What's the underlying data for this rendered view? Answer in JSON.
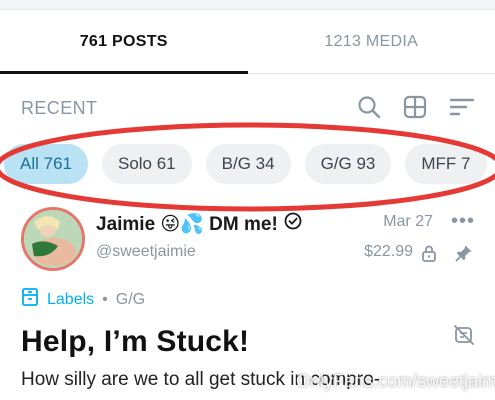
{
  "tabs": [
    {
      "label": "761 POSTS",
      "active": true
    },
    {
      "label": "1213 MEDIA",
      "active": false
    }
  ],
  "section": {
    "title": "RECENT"
  },
  "toolbar": {
    "icons": [
      "search-icon",
      "grid-icon",
      "sort-icon"
    ]
  },
  "chips": [
    {
      "label": "All 761",
      "active": true
    },
    {
      "label": "Solo 61",
      "active": false
    },
    {
      "label": "B/G 34",
      "active": false
    },
    {
      "label": "G/G 93",
      "active": false
    },
    {
      "label": "MFF 7",
      "active": false
    }
  ],
  "post": {
    "name": "Jaimie 😜💦 DM me!",
    "handle": "@sweetjaimie",
    "date": "Mar 27",
    "price": "$22.99",
    "labels_text": "Labels",
    "label_value": "G/G",
    "title": "Help, I’m Stuck!",
    "body": "How silly are we to all get stuck in compro-"
  },
  "watermark": "OnlyFans.com/sweetjaimie",
  "colors": {
    "accent": "#00aff0",
    "chip_active_bg": "#b9e3f5",
    "highlight": "#e53935",
    "muted": "#8a96a3"
  }
}
